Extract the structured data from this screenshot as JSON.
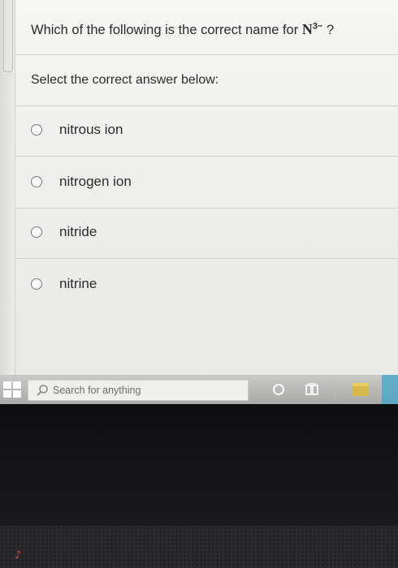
{
  "question": {
    "prefix": "Which of the following is the correct name for ",
    "formula": "N",
    "charge": "3−",
    "suffix": " ?"
  },
  "instruction": "Select the correct answer below:",
  "options": [
    {
      "label": "nitrous ion",
      "selected": false
    },
    {
      "label": "nitrogen ion",
      "selected": false
    },
    {
      "label": "nitride",
      "selected": false
    },
    {
      "label": "nitrine",
      "selected": false
    }
  ],
  "taskbar": {
    "search_placeholder": "Search for anything",
    "icons": [
      "windows-start-icon",
      "search-icon",
      "cortana-icon",
      "task-view-icon",
      "file-explorer-icon"
    ]
  },
  "colors": {
    "page_background": "#f3f3f1",
    "text": "#2b2b2b",
    "divider": "#cfcfcb",
    "taskbar": "#b9b9b7"
  }
}
